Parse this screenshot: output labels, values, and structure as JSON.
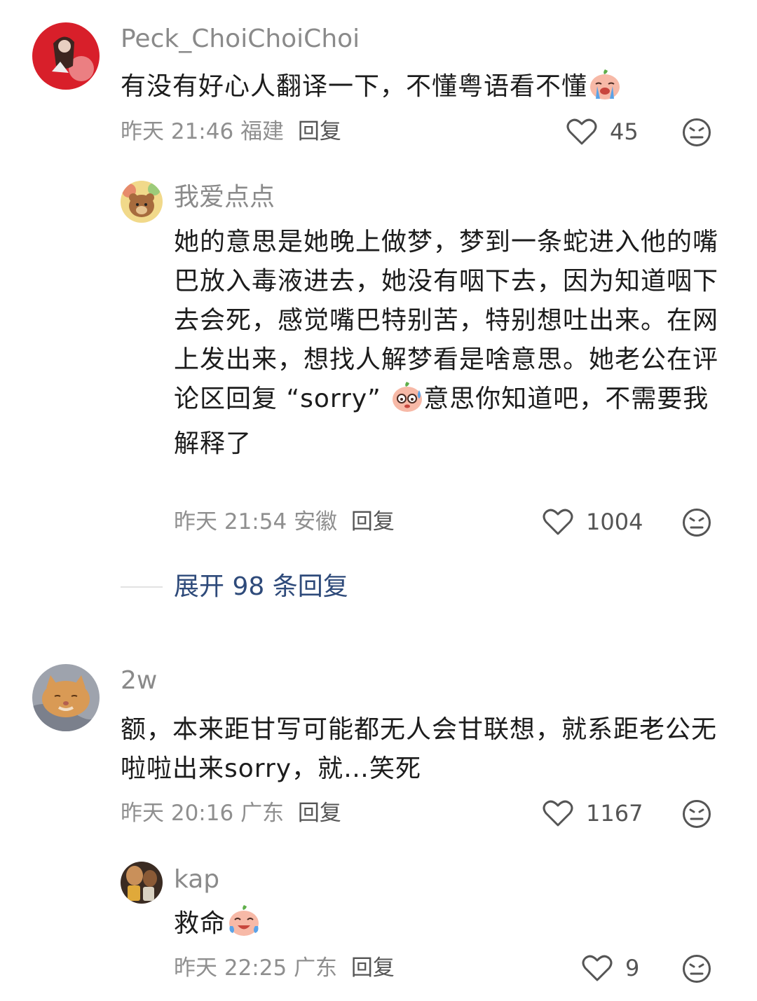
{
  "comments": [
    {
      "username": "Peck_ChoiChoiChoi",
      "text": "有没有好心人翻译一下，不懂粤语看不懂",
      "emoji": "crying-face-emoji",
      "time": "昨天 21:46",
      "location": "福建",
      "reply_label": "回复",
      "likes": "45",
      "replies": [
        {
          "username": "我爱点点",
          "text_before_emoji": "她的意思是她晚上做梦，梦到一条蛇进入他的嘴巴放入毒液进去，她没有咽下去，因为知道咽下去会死，感觉嘴巴特别苦，特别想吐出来。在网上发出来，想找人解梦看是啥意思。她老公在评论区回复 “sorry” ",
          "emoji": "sweating-face-emoji",
          "text_after_emoji": "意思你知道吧，不需要我解释了",
          "time": "昨天 21:54",
          "location": "安徽",
          "reply_label": "回复",
          "likes": "1004"
        }
      ],
      "expand_label": "展开 98 条回复"
    },
    {
      "username": "2w",
      "text": "额，本来距甘写可能都无人会甘联想，就系距老公无啦啦出来sorry，就…笑死",
      "time": "昨天 20:16",
      "location": "广东",
      "reply_label": "回复",
      "likes": "1167",
      "replies": [
        {
          "username": "kap",
          "text": "救命",
          "emoji": "crying-laughing-face-emoji",
          "time": "昨天 22:25",
          "location": "广东",
          "reply_label": "回复",
          "likes": "9"
        }
      ]
    }
  ],
  "colors": {
    "username": "#8a8a8a",
    "text": "#1c1c1c",
    "meta": "#8f8f8f",
    "expand": "#2e4a7a"
  },
  "icons": {
    "like": "heart-outline-icon",
    "dislike": "unhappy-face-icon"
  }
}
